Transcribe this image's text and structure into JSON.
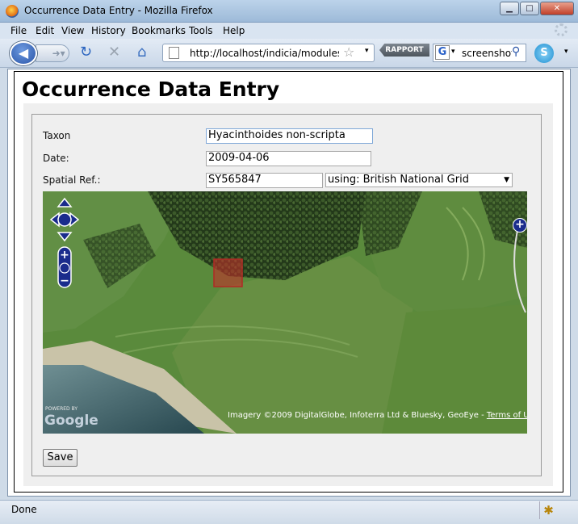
{
  "window": {
    "title": "Occurrence Data Entry - Mozilla Firefox",
    "minimize": "▁",
    "maximize": "□",
    "close": "✕"
  },
  "menubar": {
    "items": [
      "File",
      "Edit",
      "View",
      "History",
      "Bookmarks",
      "Tools",
      "Help"
    ]
  },
  "navbar": {
    "back_icon": "back-arrow-icon",
    "url": "http://localhost/indicia/modules/c",
    "rapport_label": "RAPPORT",
    "search_engine": "G",
    "search_text": "screenshot"
  },
  "page": {
    "title": "Occurrence Data Entry",
    "form": {
      "taxon_label": "Taxon",
      "taxon_value": "Hyacinthoides non-scripta",
      "date_label": "Date:",
      "date_value": "2009-04-06",
      "spatial_label": "Spatial Ref.:",
      "spatial_value": "SY565847",
      "using_label": "using:",
      "srs_value": "British National Grid",
      "save_label": "Save"
    },
    "map": {
      "attribution": "Imagery ©2009 DigitalGlobe, Infoterra Ltd & Bluesky, GeoEye - ",
      "terms": "Terms of Use",
      "powered_by": "POWERED BY",
      "google": "Google"
    }
  },
  "statusbar": {
    "text": "Done"
  },
  "colors": {
    "accent": "#2a55a8",
    "map_control": "#1a2c8c",
    "grid_square": "#c0302a"
  }
}
